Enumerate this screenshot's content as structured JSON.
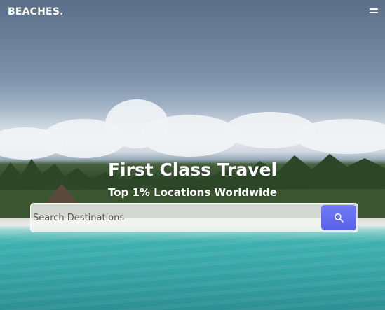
{
  "navbar": {
    "brand": "BEACHES.",
    "menu_icon": "hamburger-menu-icon"
  },
  "hero": {
    "title": "First Class Travel",
    "subtitle": "Top 1% Locations Worldwide"
  },
  "search": {
    "placeholder": "Search Destinations",
    "value": "",
    "button_icon": "search-icon",
    "button_color": "#5f67ee"
  },
  "colors": {
    "text": "#ffffff",
    "accent": "#5f67ee"
  }
}
